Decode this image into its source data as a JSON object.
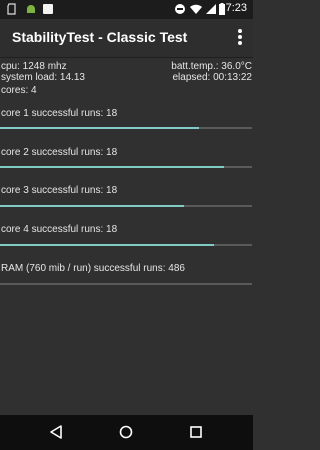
{
  "status": {
    "time": "17:23",
    "icons": [
      "sd-card-icon",
      "android-icon",
      "app-icon",
      "dnd-icon",
      "wifi-icon",
      "signal-icon",
      "battery-icon"
    ]
  },
  "app": {
    "title": "StabilityTest - Classic Test",
    "menu_icon": "overflow-menu-icon"
  },
  "info": {
    "cpu": "cpu: 1248 mhz",
    "batt_temp": "batt.temp.: 36.0°C",
    "system_load": "system load: 14.13",
    "elapsed": "elapsed: 00:13:22",
    "cores": "cores: 4"
  },
  "rows": [
    {
      "label": "core 1 successful runs: 18",
      "progress": 0.79
    },
    {
      "label": "core 2 successful runs: 18",
      "progress": 0.89
    },
    {
      "label": "core 3 successful runs: 18",
      "progress": 0.73
    },
    {
      "label": "core 4 successful runs: 18",
      "progress": 0.85
    },
    {
      "label": "RAM (760 mib / run) successful runs: 486",
      "progress": 0.0
    }
  ],
  "colors": {
    "accent": "#80cbc4",
    "track": "#5a5a5a",
    "background": "#303030"
  },
  "navbar": {
    "icons": [
      "back-icon",
      "home-icon",
      "recents-icon"
    ]
  }
}
